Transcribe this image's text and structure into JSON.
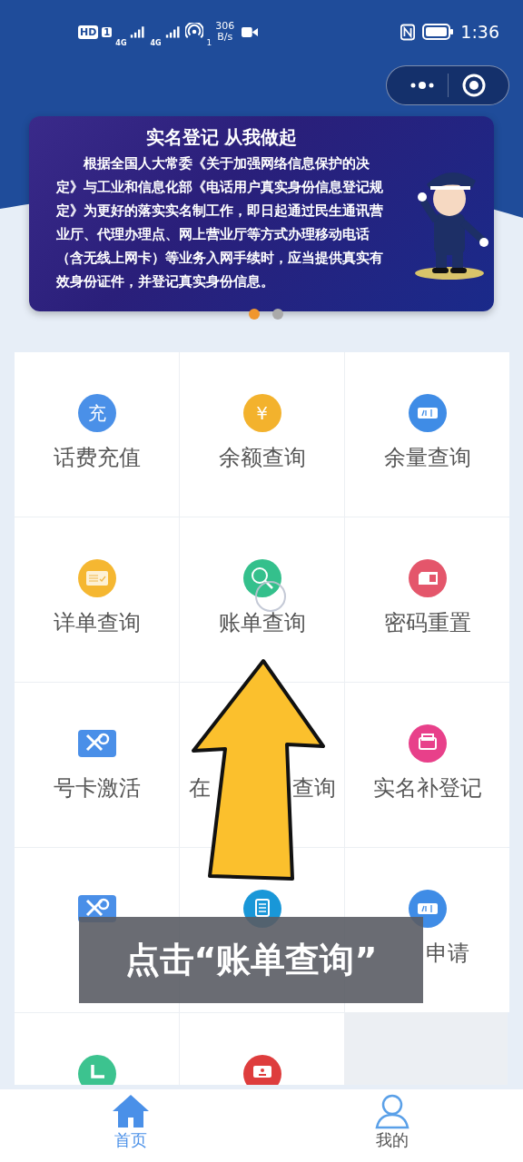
{
  "status_bar": {
    "hd": "HD",
    "sim": "1",
    "networks": [
      "4G",
      "4G"
    ],
    "hotspot": "1",
    "speed_value": "306",
    "speed_unit": "B/s",
    "time": "1:36"
  },
  "banner": {
    "title": "实名登记 从我做起",
    "body": "根据全国人大常委《关于加强网络信息保护的决定》与工业和信息化部《电话用户真实身份信息登记规定》为更好的落实实名制工作，即日起通过民生通讯营业厅、代理办理点、网上营业厅等方式办理移动电话（含无线上网卡）等业务入网手续时，应当提供真实有效身份证件，并登记真实身份信息。",
    "dots": [
      {
        "selected": true
      },
      {
        "selected": false
      }
    ]
  },
  "services": [
    {
      "kind": "labeled",
      "label": "话费充值",
      "icon_text": "充"
    },
    {
      "kind": "labeled",
      "label": "余额查询",
      "icon_text": "¥"
    },
    {
      "kind": "labeled",
      "label": "余量查询"
    },
    {
      "kind": "labeled",
      "label": "详单查询"
    },
    {
      "kind": "labeled",
      "label": "账单查询"
    },
    {
      "kind": "labeled",
      "label": "密码重置"
    },
    {
      "kind": "labeled",
      "label": "号卡激活"
    },
    {
      "kind": "split",
      "label_parts": [
        "在",
        "查询"
      ]
    },
    {
      "kind": "labeled",
      "label": "实名补登记"
    },
    {
      "kind": "unlabeled"
    },
    {
      "kind": "unlabeled"
    },
    {
      "kind": "tail",
      "label": "申请"
    },
    {
      "kind": "unlabeled"
    },
    {
      "kind": "unlabeled"
    }
  ],
  "overlay_caption": "点击“账单查询”",
  "tabs": [
    {
      "label": "首页",
      "selected": true
    },
    {
      "label": "我的",
      "selected": false
    }
  ]
}
